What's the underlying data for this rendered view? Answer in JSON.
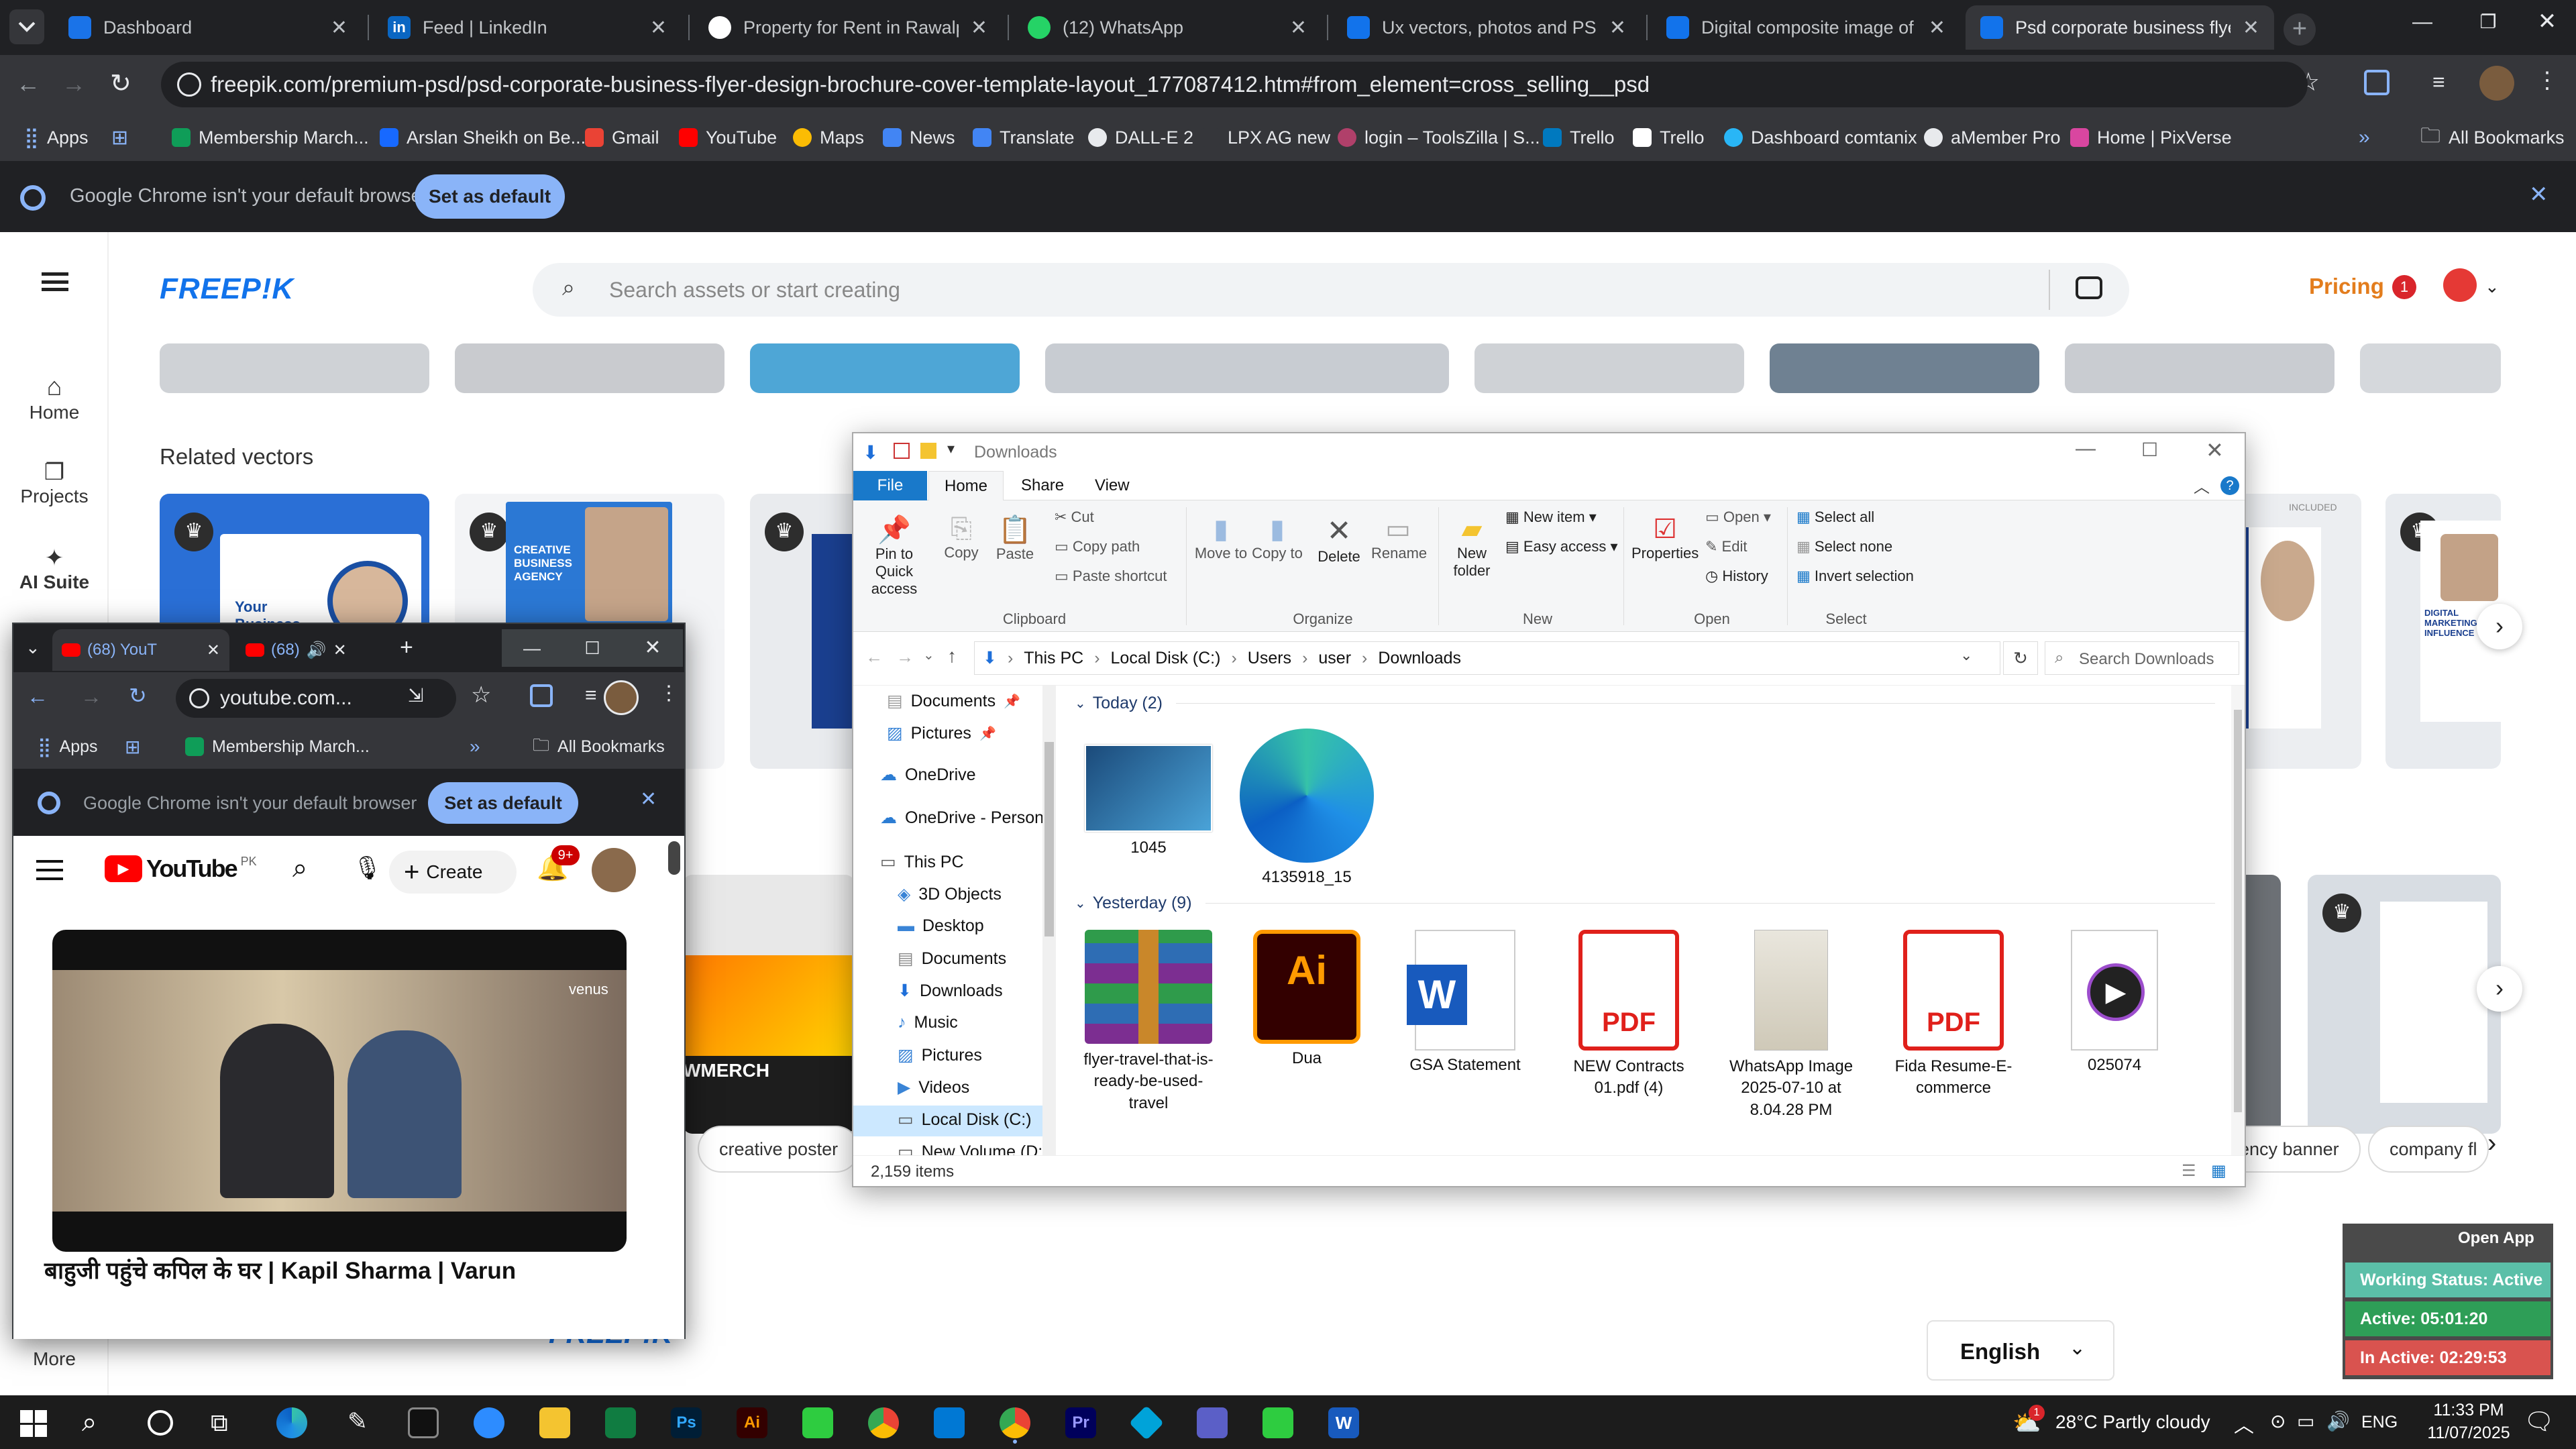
{
  "browser": {
    "tabs": [
      {
        "title": "Dashboard",
        "color": "#1a73e8"
      },
      {
        "title": "Feed | LinkedIn",
        "color": "#0a66c2"
      },
      {
        "title": "Property for Rent in Rawalpindi",
        "color": "#5f6368"
      },
      {
        "title": "(12) WhatsApp",
        "color": "#25d366"
      },
      {
        "title": "Ux vectors, photos and PSD files",
        "color": "#1273eb"
      },
      {
        "title": "Digital composite image of gra",
        "color": "#1273eb"
      },
      {
        "title": "Psd corporate business flyer de",
        "color": "#1273eb",
        "active": true
      }
    ],
    "url": "freepik.com/premium-psd/psd-corporate-business-flyer-design-brochure-cover-template-layout_177087412.htm#from_element=cross_selling__psd",
    "bookmarks": [
      "Apps",
      "Membership March...",
      "Arslan Sheikh on Be...",
      "Gmail",
      "YouTube",
      "Maps",
      "News",
      "Translate",
      "DALL-E 2",
      "LPX AG new",
      "login – ToolsZilla | S...",
      "Trello",
      "Trello",
      "Dashboard comtanix",
      "aMember Pro",
      "Home | PixVerse"
    ],
    "all_bookmarks": "All Bookmarks",
    "infobar_text": "Google Chrome isn't your default browser",
    "set_default_label": "Set as default"
  },
  "freepik": {
    "logo": "FREEP!K",
    "search_placeholder": "Search assets or start creating",
    "pricing": "Pricing",
    "notification_count": "1",
    "nav": [
      {
        "label": "Home"
      },
      {
        "label": "Projects"
      },
      {
        "label": "AI Suite"
      },
      {
        "label": "More"
      }
    ],
    "related_vectors_heading": "Related vectors",
    "card_texts": {
      "business_promotion": "Your Business Promotion",
      "creative_agency": "CREATIVE BUSINESS AGENCY",
      "digital_marketing": "DIGITAL MARKETING INFLUENCE",
      "included": "INCLUDED",
      "merch": "WMERCH"
    },
    "chips": [
      "creative poster",
      "ency banner",
      "company fl"
    ],
    "footer_logo": "FREEP!K",
    "language": "English"
  },
  "explorer": {
    "title": "Downloads",
    "ribbon_tabs": [
      "File",
      "Home",
      "Share",
      "View"
    ],
    "clipboard": {
      "pin": "Pin to Quick access",
      "copy": "Copy",
      "paste": "Paste",
      "cut": "Cut",
      "copy_path": "Copy path",
      "paste_shortcut": "Paste shortcut",
      "group": "Clipboard"
    },
    "organize": {
      "move_to": "Move to",
      "copy_to": "Copy to",
      "delete": "Delete",
      "rename": "Rename",
      "group": "Organize"
    },
    "new": {
      "new_folder": "New folder",
      "new_item": "New item",
      "easy_access": "Easy access",
      "group": "New"
    },
    "open": {
      "properties": "Properties",
      "open": "Open",
      "edit": "Edit",
      "history": "History",
      "group": "Open"
    },
    "select": {
      "select_all": "Select all",
      "select_none": "Select none",
      "invert": "Invert selection",
      "group": "Select"
    },
    "path": [
      "This PC",
      "Local Disk (C:)",
      "Users",
      "user",
      "Downloads"
    ],
    "search_placeholder": "Search Downloads",
    "tree": [
      "Documents",
      "Pictures",
      "OneDrive",
      "OneDrive - Person",
      "This PC",
      "3D Objects",
      "Desktop",
      "Documents",
      "Downloads",
      "Music",
      "Pictures",
      "Videos",
      "Local Disk (C:)",
      "New Volume (D:)"
    ],
    "groups": [
      {
        "label": "Today (2)",
        "files": [
          "1045",
          "4135918_15"
        ]
      },
      {
        "label": "Yesterday (9)",
        "files": [
          "flyer-travel-that-is-ready-be-used-travel",
          "Dua",
          "GSA Statement",
          "NEW Contracts 01.pdf (4)",
          "WhatsApp Image 2025-07-10 at 8.04.28 PM",
          "Fida Resume-E-commerce",
          "025074"
        ]
      }
    ],
    "status": "2,159 items"
  },
  "youtube_window": {
    "tabs": [
      "(68) YouT",
      "(68)"
    ],
    "url": "youtube.com...",
    "bookmark": "Membership March...",
    "apps": "Apps",
    "all_bookmarks": "All Bookmarks",
    "infobar_text": "Google Chrome isn't your default browser",
    "set_default": "Set as default",
    "logo_text": "YouTube",
    "country": "PK",
    "create": "Create",
    "badge": "9+",
    "video_watermark": "venus",
    "video_title": "बाहुजी पहुंचे कपिल के घर | Kapil Sharma | Varun"
  },
  "tracker": {
    "open_app": "Open App",
    "working_status": "Working Status: Active",
    "active": "Active: 05:01:20",
    "inactive": "In Active: 02:29:53",
    "colors": {
      "status": "#5bbfa8",
      "active": "#2e9e57",
      "inactive": "#d9534f"
    }
  },
  "taskbar": {
    "weather": "28°C  Partly cloudy",
    "weather_badge": "1",
    "lang": "ENG",
    "time": "11:33 PM",
    "date": "11/07/2025"
  }
}
